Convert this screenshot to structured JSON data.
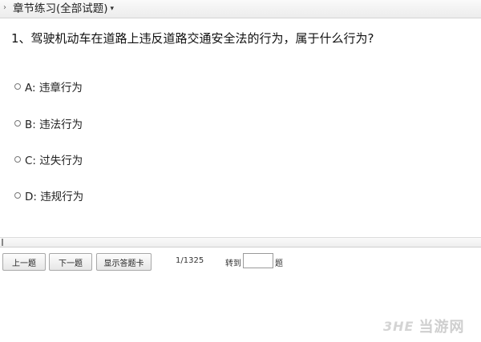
{
  "toolbar": {
    "chevron": "›",
    "title": "章节练习(全部试题)",
    "dropdown_glyph": "▾"
  },
  "question": {
    "text": "1、驾驶机动车在道路上违反道路交通安全法的行为，属于什么行为?"
  },
  "options": [
    {
      "label": "A: 违章行为",
      "selected": false
    },
    {
      "label": "B: 违法行为",
      "selected": false
    },
    {
      "label": "C: 过失行为",
      "selected": false
    },
    {
      "label": "D: 违规行为",
      "selected": false
    }
  ],
  "nav": {
    "prev_label": "上一题",
    "next_label": "下一题",
    "show_card_label": "显示答题卡",
    "page_info": "1/1325",
    "goto_label": "转到",
    "goto_value": "",
    "goto_suffix": "题"
  },
  "watermark": {
    "logo": "3HE",
    "text": "当游网"
  }
}
